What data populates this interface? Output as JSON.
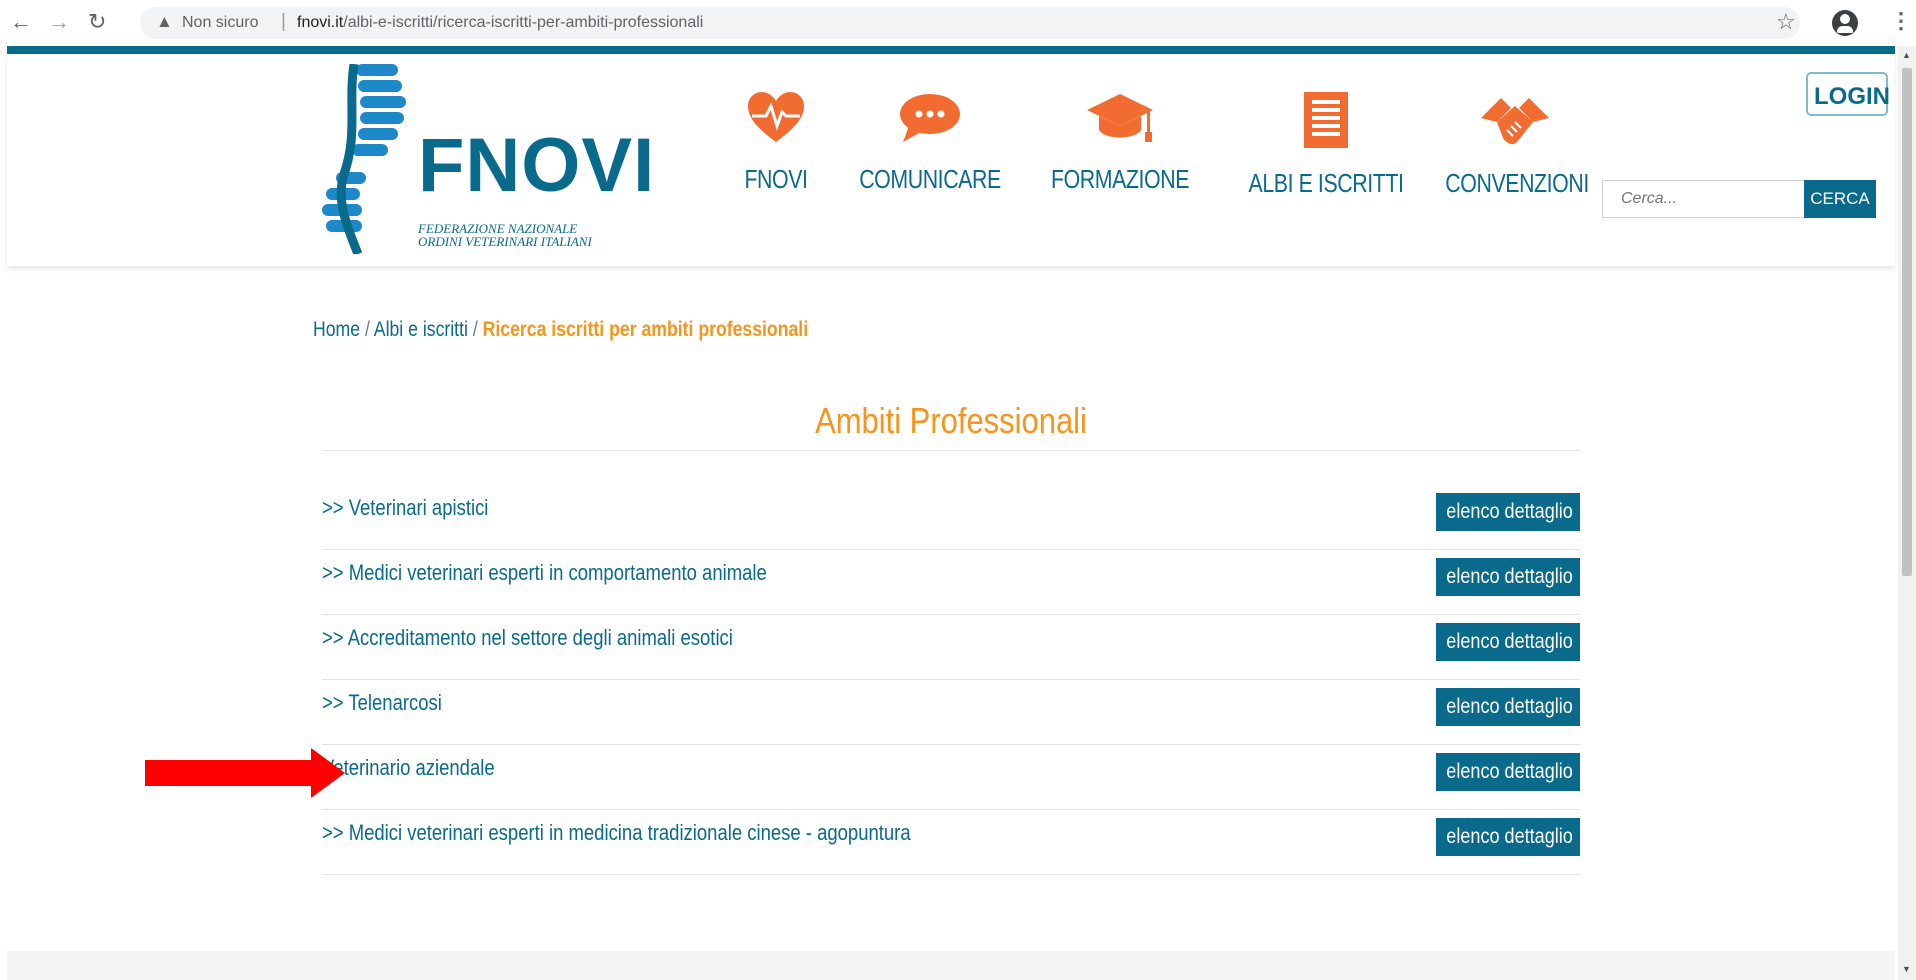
{
  "browser": {
    "back_icon": "back-arrow-icon",
    "forward_icon": "forward-arrow-icon",
    "reload_icon": "reload-icon",
    "warning_icon": "warning-icon",
    "insecure_label": "Non sicuro",
    "separator": "|",
    "url_host": "fnovi.it",
    "url_path": "/albi-e-iscritti/ricerca-iscritti-per-ambiti-professionali"
  },
  "header": {
    "logo_text": "FNOVI",
    "logo_sub_1": "FEDERAZIONE NAZIONALE",
    "logo_sub_2": "ORDINI VETERINARI ITALIANI",
    "nav": [
      {
        "label": "FNOVI",
        "icon": "heart-pulse-icon"
      },
      {
        "label": "COMUNICARE",
        "icon": "speech-bubble-icon"
      },
      {
        "label": "FORMAZIONE",
        "icon": "graduation-cap-icon"
      },
      {
        "label": "ALBI E ISCRITTI",
        "icon": "document-list-icon"
      },
      {
        "label": "CONVENZIONI",
        "icon": "handshake-icon"
      }
    ],
    "login_label": "LOGIN",
    "search_placeholder": "Cerca...",
    "search_button": "CERCA"
  },
  "breadcrumb": {
    "home": "Home",
    "sep": " / ",
    "parent": "Albi e iscritti",
    "current": "Ricerca iscritti per ambiti professionali"
  },
  "section_title": "Ambiti Professionali",
  "items": [
    {
      "label": ">> Veterinari apistici",
      "button": "elenco dettaglio"
    },
    {
      "label": ">> Medici veterinari esperti in comportamento animale",
      "button": "elenco dettaglio"
    },
    {
      "label": ">> Accreditamento nel settore degli animali esotici",
      "button": "elenco dettaglio"
    },
    {
      "label": ">> Telenarcosi",
      "button": "elenco dettaglio"
    },
    {
      "label": "Veterinario aziendale",
      "button": "elenco dettaglio"
    },
    {
      "label": ">> Medici veterinari esperti in medicina tradizionale cinese - agopuntura",
      "button": "elenco dettaglio"
    }
  ],
  "colors": {
    "brand_blue": "#0a6a8c",
    "accent_orange": "#f7941d",
    "nav_icon_orange": "#f26c32",
    "annotation_red": "#ff0000"
  }
}
